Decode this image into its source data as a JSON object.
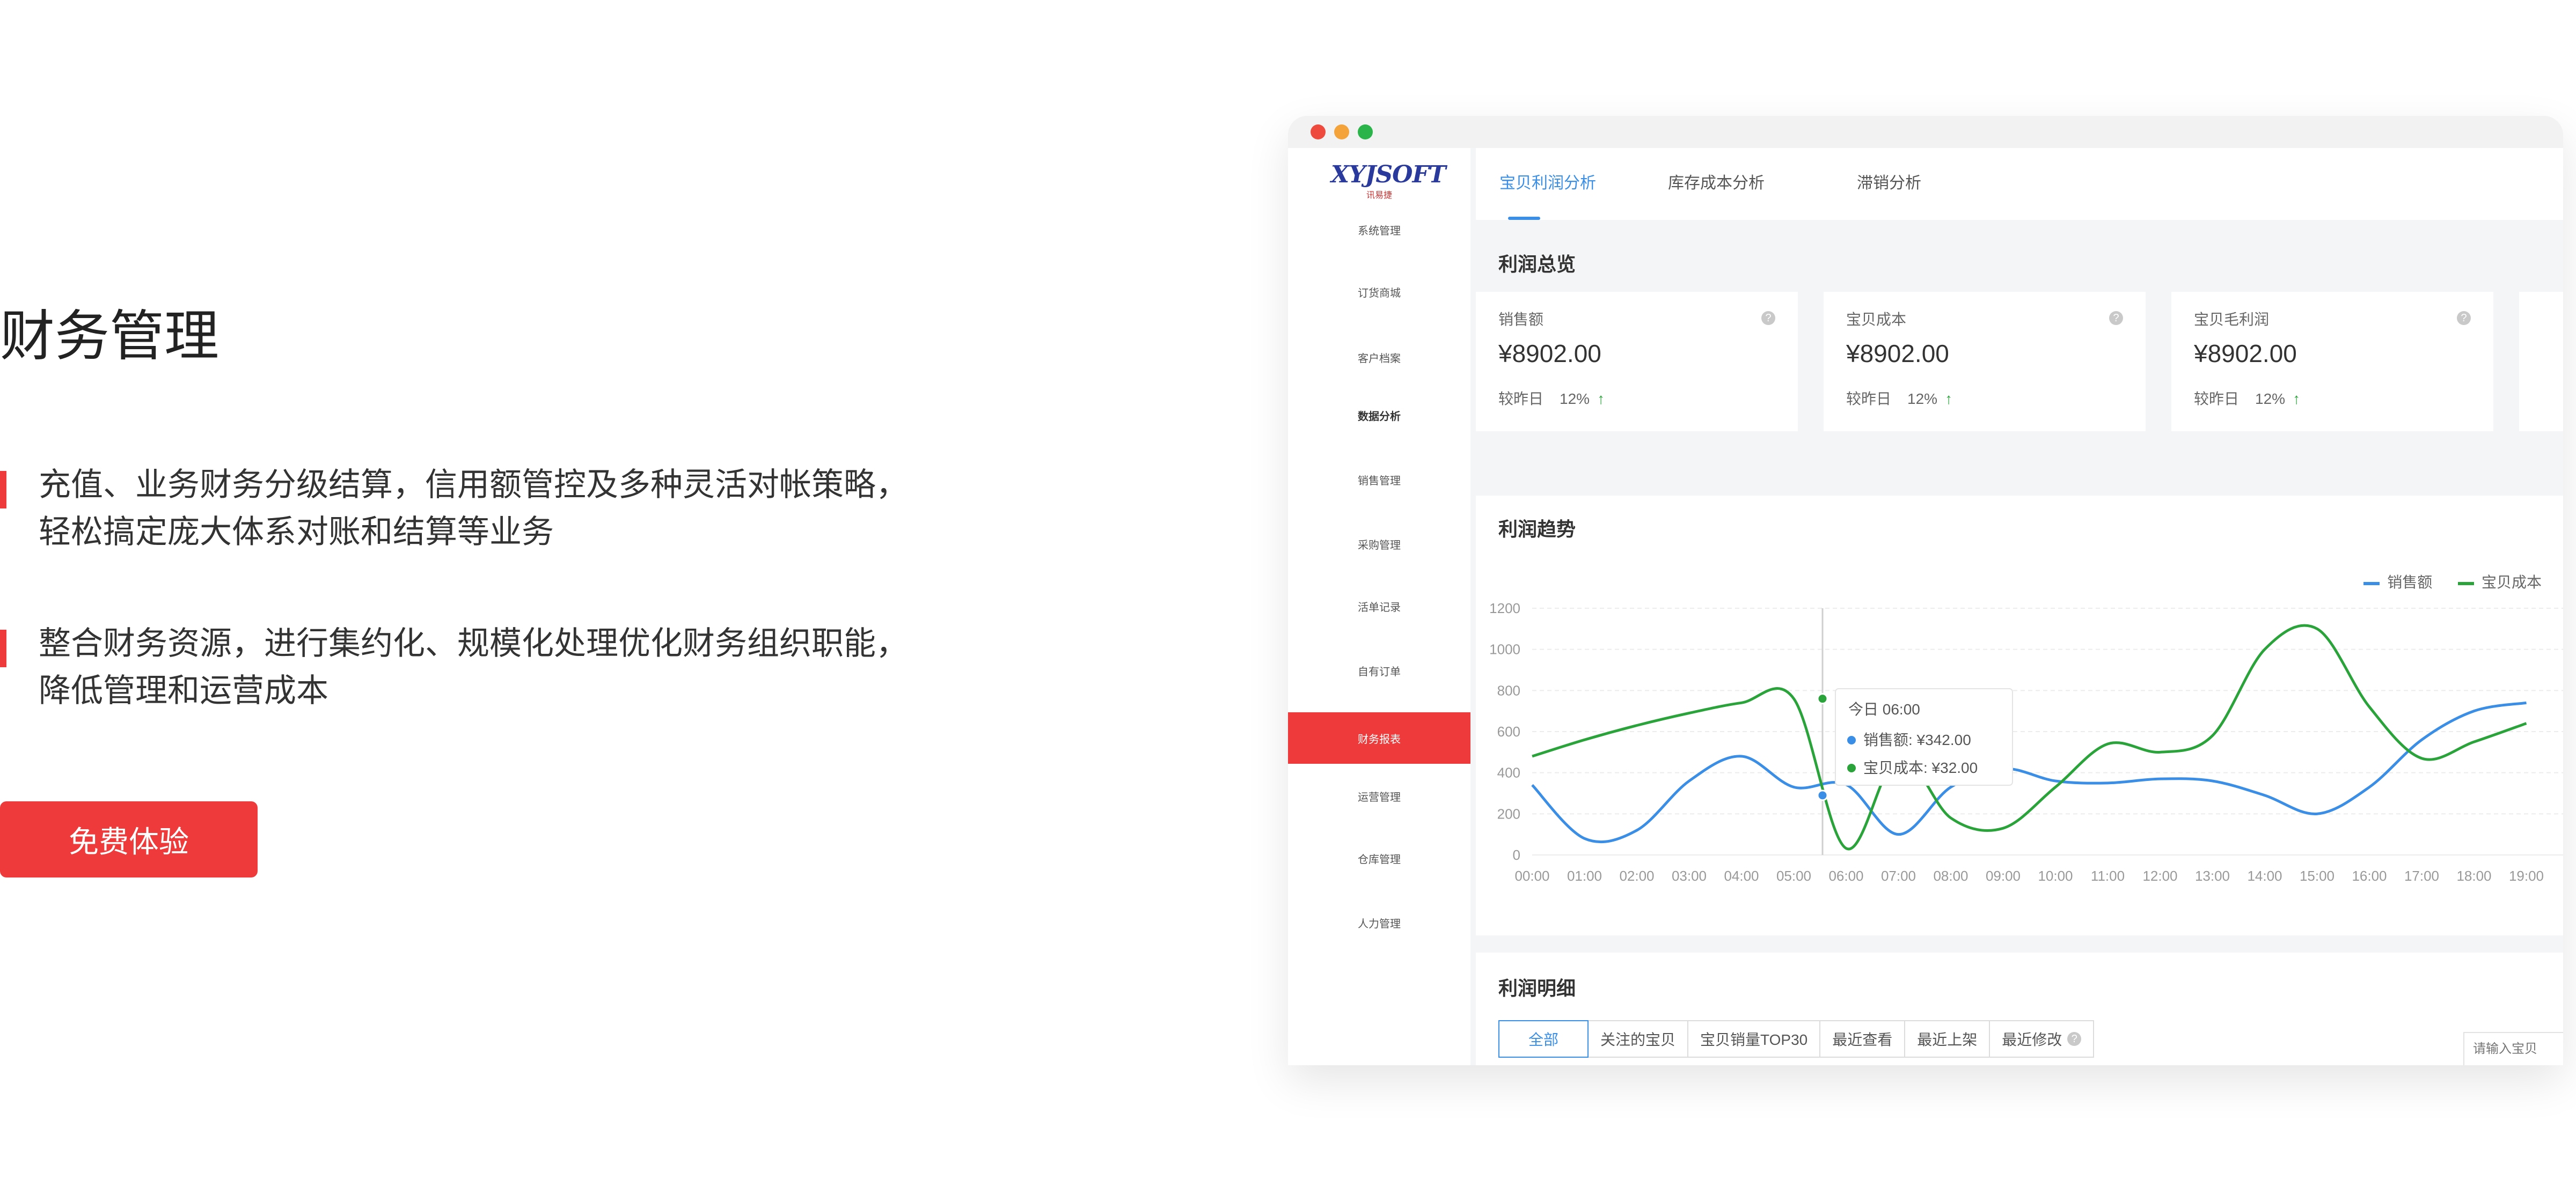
{
  "hero": {
    "title": "财务管理",
    "features": [
      {
        "line1": "充值、业务财务分级结算，信用额管控及多种灵活对帐策略，",
        "line2": "轻松搞定庞大体系对账和结算等业务"
      },
      {
        "line1": "整合财务资源，进行集约化、规模化处理优化财务组织职能，",
        "line2": "降低管理和运营成本"
      }
    ],
    "cta_label": "免费体验"
  },
  "app": {
    "logo": {
      "brand": "XYJSOFT",
      "sub": "讯易捷"
    },
    "sidebar": [
      {
        "label": "系统管理"
      },
      {
        "label": "订货商城"
      },
      {
        "label": "客户档案"
      },
      {
        "label": "数据分析"
      },
      {
        "label": "销售管理"
      },
      {
        "label": "采购管理"
      },
      {
        "label": "活单记录"
      },
      {
        "label": "自有订单"
      },
      {
        "label": "财务报表"
      },
      {
        "label": "运营管理"
      },
      {
        "label": "仓库管理"
      },
      {
        "label": "人力管理"
      }
    ],
    "tabs": [
      "宝贝利润分析",
      "库存成本分析",
      "滞销分析"
    ],
    "overview_title": "利润总览",
    "cards": [
      {
        "label": "销售额",
        "value": "¥8902.00",
        "compare": "较昨日",
        "pct": "12%",
        "arrow": "↑"
      },
      {
        "label": "宝贝成本",
        "value": "¥8902.00",
        "compare": "较昨日",
        "pct": "12%",
        "arrow": "↑"
      },
      {
        "label": "宝贝毛利润",
        "value": "¥8902.00",
        "compare": "较昨日",
        "pct": "12%",
        "arrow": "↑"
      }
    ],
    "trend_title": "利润趋势",
    "legend": [
      "销售额",
      "宝贝成本"
    ],
    "detail_title": "利润明细",
    "filters": [
      "全部",
      "关注的宝贝",
      "宝贝销量TOP30",
      "最近查看",
      "最近上架",
      "最近修改"
    ],
    "search_placeholder": "请输入宝贝",
    "help_icon": "?"
  },
  "colors": {
    "accent": "#ee3a3a",
    "blue": "#3a8ee6",
    "green": "#2aa43a"
  },
  "chart_data": {
    "type": "line",
    "x": [
      "00:00",
      "01:00",
      "02:00",
      "03:00",
      "04:00",
      "05:00",
      "06:00",
      "07:00",
      "08:00",
      "09:00",
      "10:00",
      "11:00",
      "12:00",
      "13:00",
      "14:00",
      "15:00",
      "16:00",
      "17:00",
      "18:00",
      "19:00"
    ],
    "series": [
      {
        "name": "销售额",
        "color": "#3a8ee6",
        "values": [
          340,
          80,
          120,
          360,
          480,
          330,
          342,
          100,
          330,
          420,
          360,
          350,
          370,
          360,
          290,
          200,
          330,
          560,
          700,
          740
        ]
      },
      {
        "name": "宝贝成本",
        "color": "#2aa43a",
        "values": [
          480,
          560,
          630,
          690,
          740,
          760,
          32,
          480,
          180,
          130,
          330,
          540,
          500,
          580,
          1000,
          1100,
          720,
          470,
          550,
          640
        ]
      }
    ],
    "yticks": [
      0,
      200,
      400,
      600,
      800,
      1000,
      1200
    ],
    "ylim": [
      0,
      1200
    ],
    "tooltip": {
      "title": "今日 06:00",
      "rows": [
        {
          "label": "销售额: ¥342.00",
          "color": "#3a8ee6"
        },
        {
          "label": "宝贝成本: ¥32.00",
          "color": "#2aa43a"
        }
      ]
    }
  }
}
